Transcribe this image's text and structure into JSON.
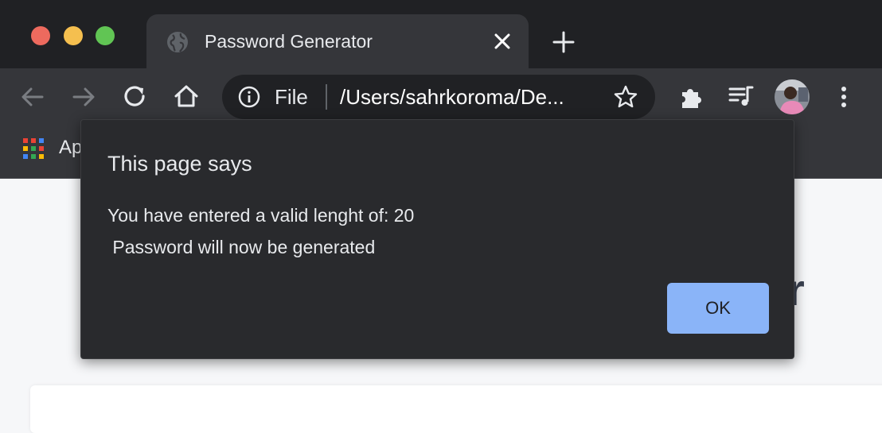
{
  "browser": {
    "tab": {
      "title": "Password Generator"
    },
    "omnibox": {
      "scheme": "File",
      "url": "/Users/sahrkoroma/De..."
    },
    "bookmarks": {
      "apps_label": "Apps"
    }
  },
  "page": {
    "heading_fragment": "ator"
  },
  "dialog": {
    "title": "This page says",
    "message": "You have entered a valid lenght of: 20\n Password will now be generated",
    "ok_label": "OK"
  },
  "colors": {
    "accent": "#8ab4f8",
    "dialog_bg": "#292a2d",
    "toolbar_bg": "#35363a",
    "titlebar_bg": "#202124"
  }
}
